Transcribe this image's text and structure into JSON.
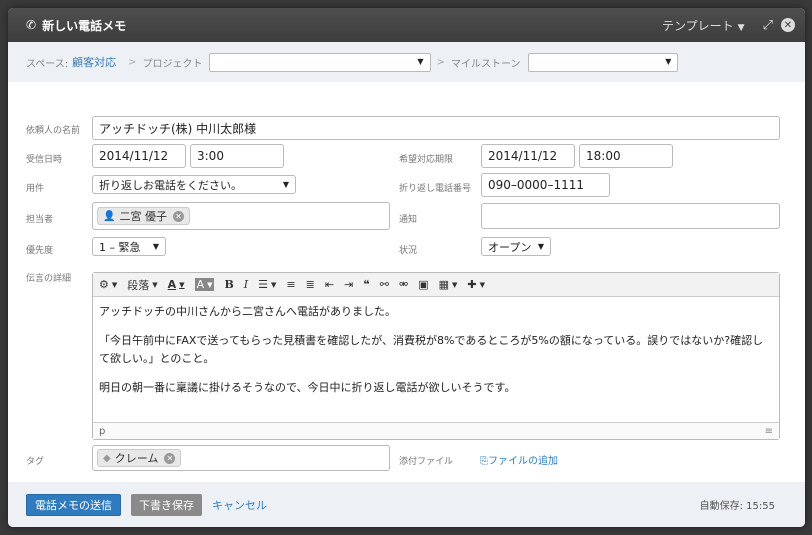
{
  "titlebar": {
    "title": "新しい電話メモ",
    "template_label": "テンプレート",
    "icons": [
      "phone-icon",
      "expand-icon",
      "close-icon"
    ]
  },
  "crumbs": {
    "space_label": "スペース:",
    "space_value": "顧客対応",
    "project_label": "プロジェクト",
    "project_value": "",
    "milestone_label": "マイルストーン",
    "milestone_value": ""
  },
  "form": {
    "requester_label": "依頼人の名前",
    "requester_value": "アッチドッチ(株) 中川太郎様",
    "received_label": "受信日時",
    "received_date": "2014/11/12",
    "received_time": "3:00",
    "desired_label": "希望対応期限",
    "desired_date": "2014/11/12",
    "desired_time": "18:00",
    "subject_label": "用件",
    "subject_value": "折り返しお電話をください。",
    "callback_label": "折り返し電話番号",
    "callback_value": "090–0000–1111",
    "assignee_label": "担当者",
    "assignee_value": "二宮 優子",
    "notify_label": "通知",
    "notify_value": "",
    "priority_label": "優先度",
    "priority_value": "1 – 緊急",
    "status_label": "状況",
    "status_value": "オープン",
    "details_label": "伝言の詳細",
    "toolbar_paragraph": "段落",
    "details_lines": [
      "アッチドッチの中川さんから二宮さんへ電話がありました。",
      "「今日午前中にFAXで送ってもらった見積書を確認したが、消費税が8%であるところが5%の額になっている。誤りではないか?確認して欲しい。」とのこと。",
      "明日の朝一番に稟議に掛けるそうなので、今日中に折り返し電話が欲しいそうです。"
    ],
    "editor_path": "p",
    "tag_label": "タグ",
    "tag_value": "クレーム",
    "attach_label": "添付ファイル",
    "attach_link": "ファイルの追加"
  },
  "footer": {
    "send_button": "電話メモの送信",
    "draft_button": "下書き保存",
    "cancel_link": "キャンセル",
    "autosave": "自動保存: 15:55"
  },
  "colors": {
    "accent": "#2f7bbd",
    "titlebar": "#444444",
    "crumb_bg": "#edf1f5"
  }
}
